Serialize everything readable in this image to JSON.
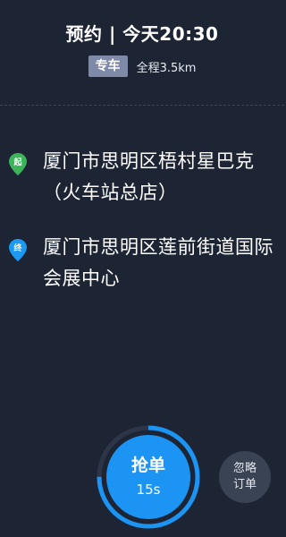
{
  "header": {
    "title": "预约 | 今天20:30",
    "car_type_badge": "专车",
    "total_distance": "全程3.5km"
  },
  "route": {
    "start": {
      "marker_label": "起",
      "marker_color": "#3cb55a",
      "address": "厦门市思明区梧村星巴克（火车站总店）"
    },
    "end": {
      "marker_label": "终",
      "marker_color": "#1a9af2",
      "address": "厦门市思明区莲前街道国际会展中心"
    }
  },
  "actions": {
    "grab_label": "抢单",
    "countdown": "15s",
    "countdown_progress": 0.75,
    "ignore_line1": "忽略",
    "ignore_line2": "订单"
  },
  "colors": {
    "background": "#1d2535",
    "accent": "#1b94f4",
    "badge": "#7f8aa8"
  }
}
